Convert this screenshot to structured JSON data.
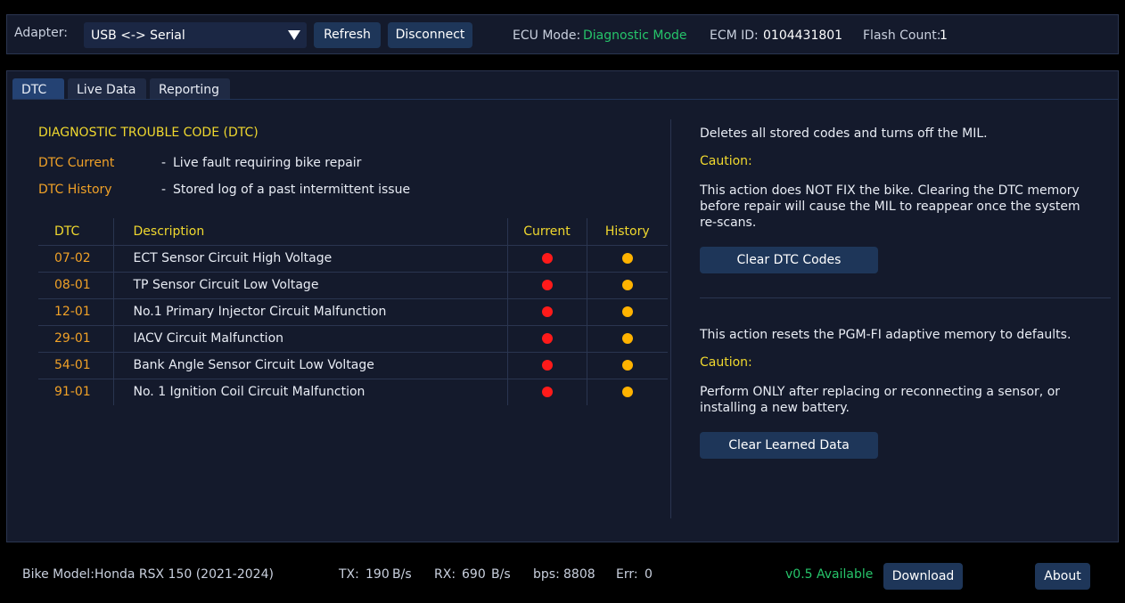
{
  "topbar": {
    "adapter_label": "Adapter:",
    "adapter_value": "USB <-> Serial",
    "refresh_label": "Refresh",
    "disconnect_label": "Disconnect",
    "ecu_mode_label": "ECU Mode:",
    "ecu_mode_value": "Diagnostic Mode",
    "ecm_id_label": "ECM ID:",
    "ecm_id_value": "0104431801",
    "flash_count_label": "Flash Count:",
    "flash_count_value": "1"
  },
  "tabs": [
    {
      "label": "DTC",
      "active": true
    },
    {
      "label": "Live Data",
      "active": false
    },
    {
      "label": "Reporting",
      "active": false
    }
  ],
  "dtc_panel": {
    "heading": "DIAGNOSTIC TROUBLE CODE (DTC)",
    "legend": [
      {
        "key": "DTC Current",
        "dash": "-",
        "desc": "Live fault requiring bike repair"
      },
      {
        "key": "DTC History",
        "dash": "-",
        "desc": "Stored log of a past intermittent issue"
      }
    ],
    "columns": {
      "code": "DTC",
      "desc": "Description",
      "current": "Current",
      "history": "History"
    },
    "rows": [
      {
        "code": "07-02",
        "desc": "ECT Sensor Circuit High Voltage",
        "current": true,
        "history": true
      },
      {
        "code": "08-01",
        "desc": "TP Sensor Circuit Low Voltage",
        "current": true,
        "history": true
      },
      {
        "code": "12-01",
        "desc": "No.1 Primary Injector Circuit Malfunction",
        "current": true,
        "history": true
      },
      {
        "code": "29-01",
        "desc": "IACV Circuit Malfunction",
        "current": true,
        "history": true
      },
      {
        "code": "54-01",
        "desc": "Bank Angle Sensor Circuit Low Voltage",
        "current": true,
        "history": true
      },
      {
        "code": "91-01",
        "desc": "No. 1 Ignition Coil Circuit Malfunction",
        "current": true,
        "history": true
      }
    ]
  },
  "clear_dtc": {
    "intro": "Deletes all stored codes and turns off the MIL.",
    "caution_label": "Caution:",
    "caution_line1": "This action does NOT FIX the bike. Clearing the DTC memory",
    "caution_line2": "before repair will cause the MIL to reappear once the system",
    "caution_line3": "re-scans.",
    "button_label": "Clear DTC Codes"
  },
  "clear_learned": {
    "intro": "This action resets the PGM-FI adaptive memory to defaults.",
    "caution_label": "Caution:",
    "caution_line1": "Perform ONLY after replacing or reconnecting a sensor, or",
    "caution_line2": "installing a new battery.",
    "button_label": "Clear Learned Data"
  },
  "statusbar": {
    "bike_model_label": "Bike Model:",
    "bike_model_value": "Honda RSX 150 (2021-2024)",
    "tx_label": "TX:",
    "tx_value": "190",
    "tx_unit": "B/s",
    "rx_label": "RX:",
    "rx_value": "690",
    "rx_unit": "B/s",
    "bps_label": "bps:",
    "bps_value": "8808",
    "err_label": "Err:",
    "err_value": "0",
    "update_text": "v0.5 Available",
    "download_label": "Download",
    "about_label": "About"
  },
  "colors": {
    "background": "#000000",
    "panel": "#141a2c",
    "button": "#1e3659",
    "heading_yellow": "#f0d82e",
    "code_orange": "#f0a127",
    "current_dot": "#ff1a1a",
    "history_dot": "#ffb300",
    "status_green": "#26c46a"
  }
}
